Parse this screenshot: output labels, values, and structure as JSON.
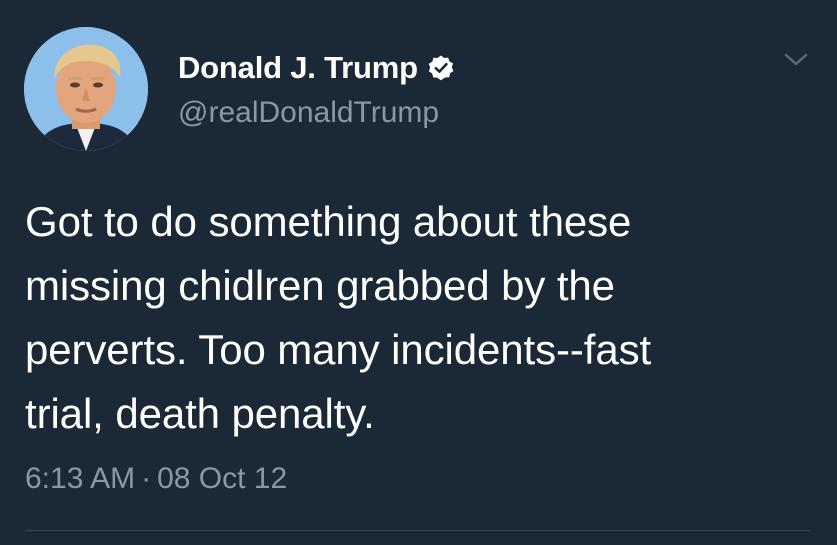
{
  "tweet": {
    "author": {
      "display_name": "Donald J. Trump",
      "handle": "@realDonaldTrump",
      "verified": true,
      "verified_icon": "verified-badge-icon",
      "avatar": "profile-photo"
    },
    "text": "Got to do something about these\nmissing chidlren grabbed by the\nperverts. Too many incidents--fast\ntrial, death penalty.",
    "time": "6:13 AM",
    "separator": "·",
    "date": "08 Oct 12",
    "menu_icon": "chevron-down-icon"
  },
  "colors": {
    "background": "#1b2836",
    "text_primary": "#ffffff",
    "text_secondary": "#8899a6",
    "divider": "#38444d"
  }
}
